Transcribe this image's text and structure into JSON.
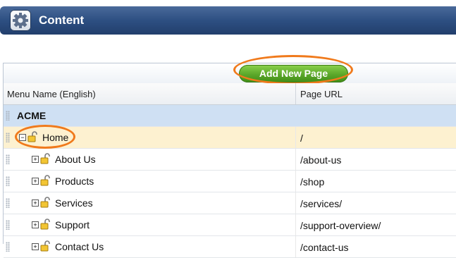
{
  "header": {
    "title": "Content",
    "icon": "gear-icon"
  },
  "toolbar": {
    "add_label": "Add New Page"
  },
  "columns": {
    "name": "Menu Name (English)",
    "url": "Page URL"
  },
  "rows": [
    {
      "name": "ACME",
      "url": ""
    },
    {
      "name": "Home",
      "url": "/"
    },
    {
      "name": "About Us",
      "url": "/about-us"
    },
    {
      "name": "Products",
      "url": "/shop"
    },
    {
      "name": "Services",
      "url": "/services/"
    },
    {
      "name": "Support",
      "url": "/support-overview/"
    },
    {
      "name": "Contact Us",
      "url": "/contact-us"
    }
  ],
  "colors": {
    "highlight_ring": "#f07a1c",
    "button_green": "#5ba72a",
    "root_row_bg": "#cfe0f3",
    "selected_row_bg": "#fdf1d0"
  }
}
